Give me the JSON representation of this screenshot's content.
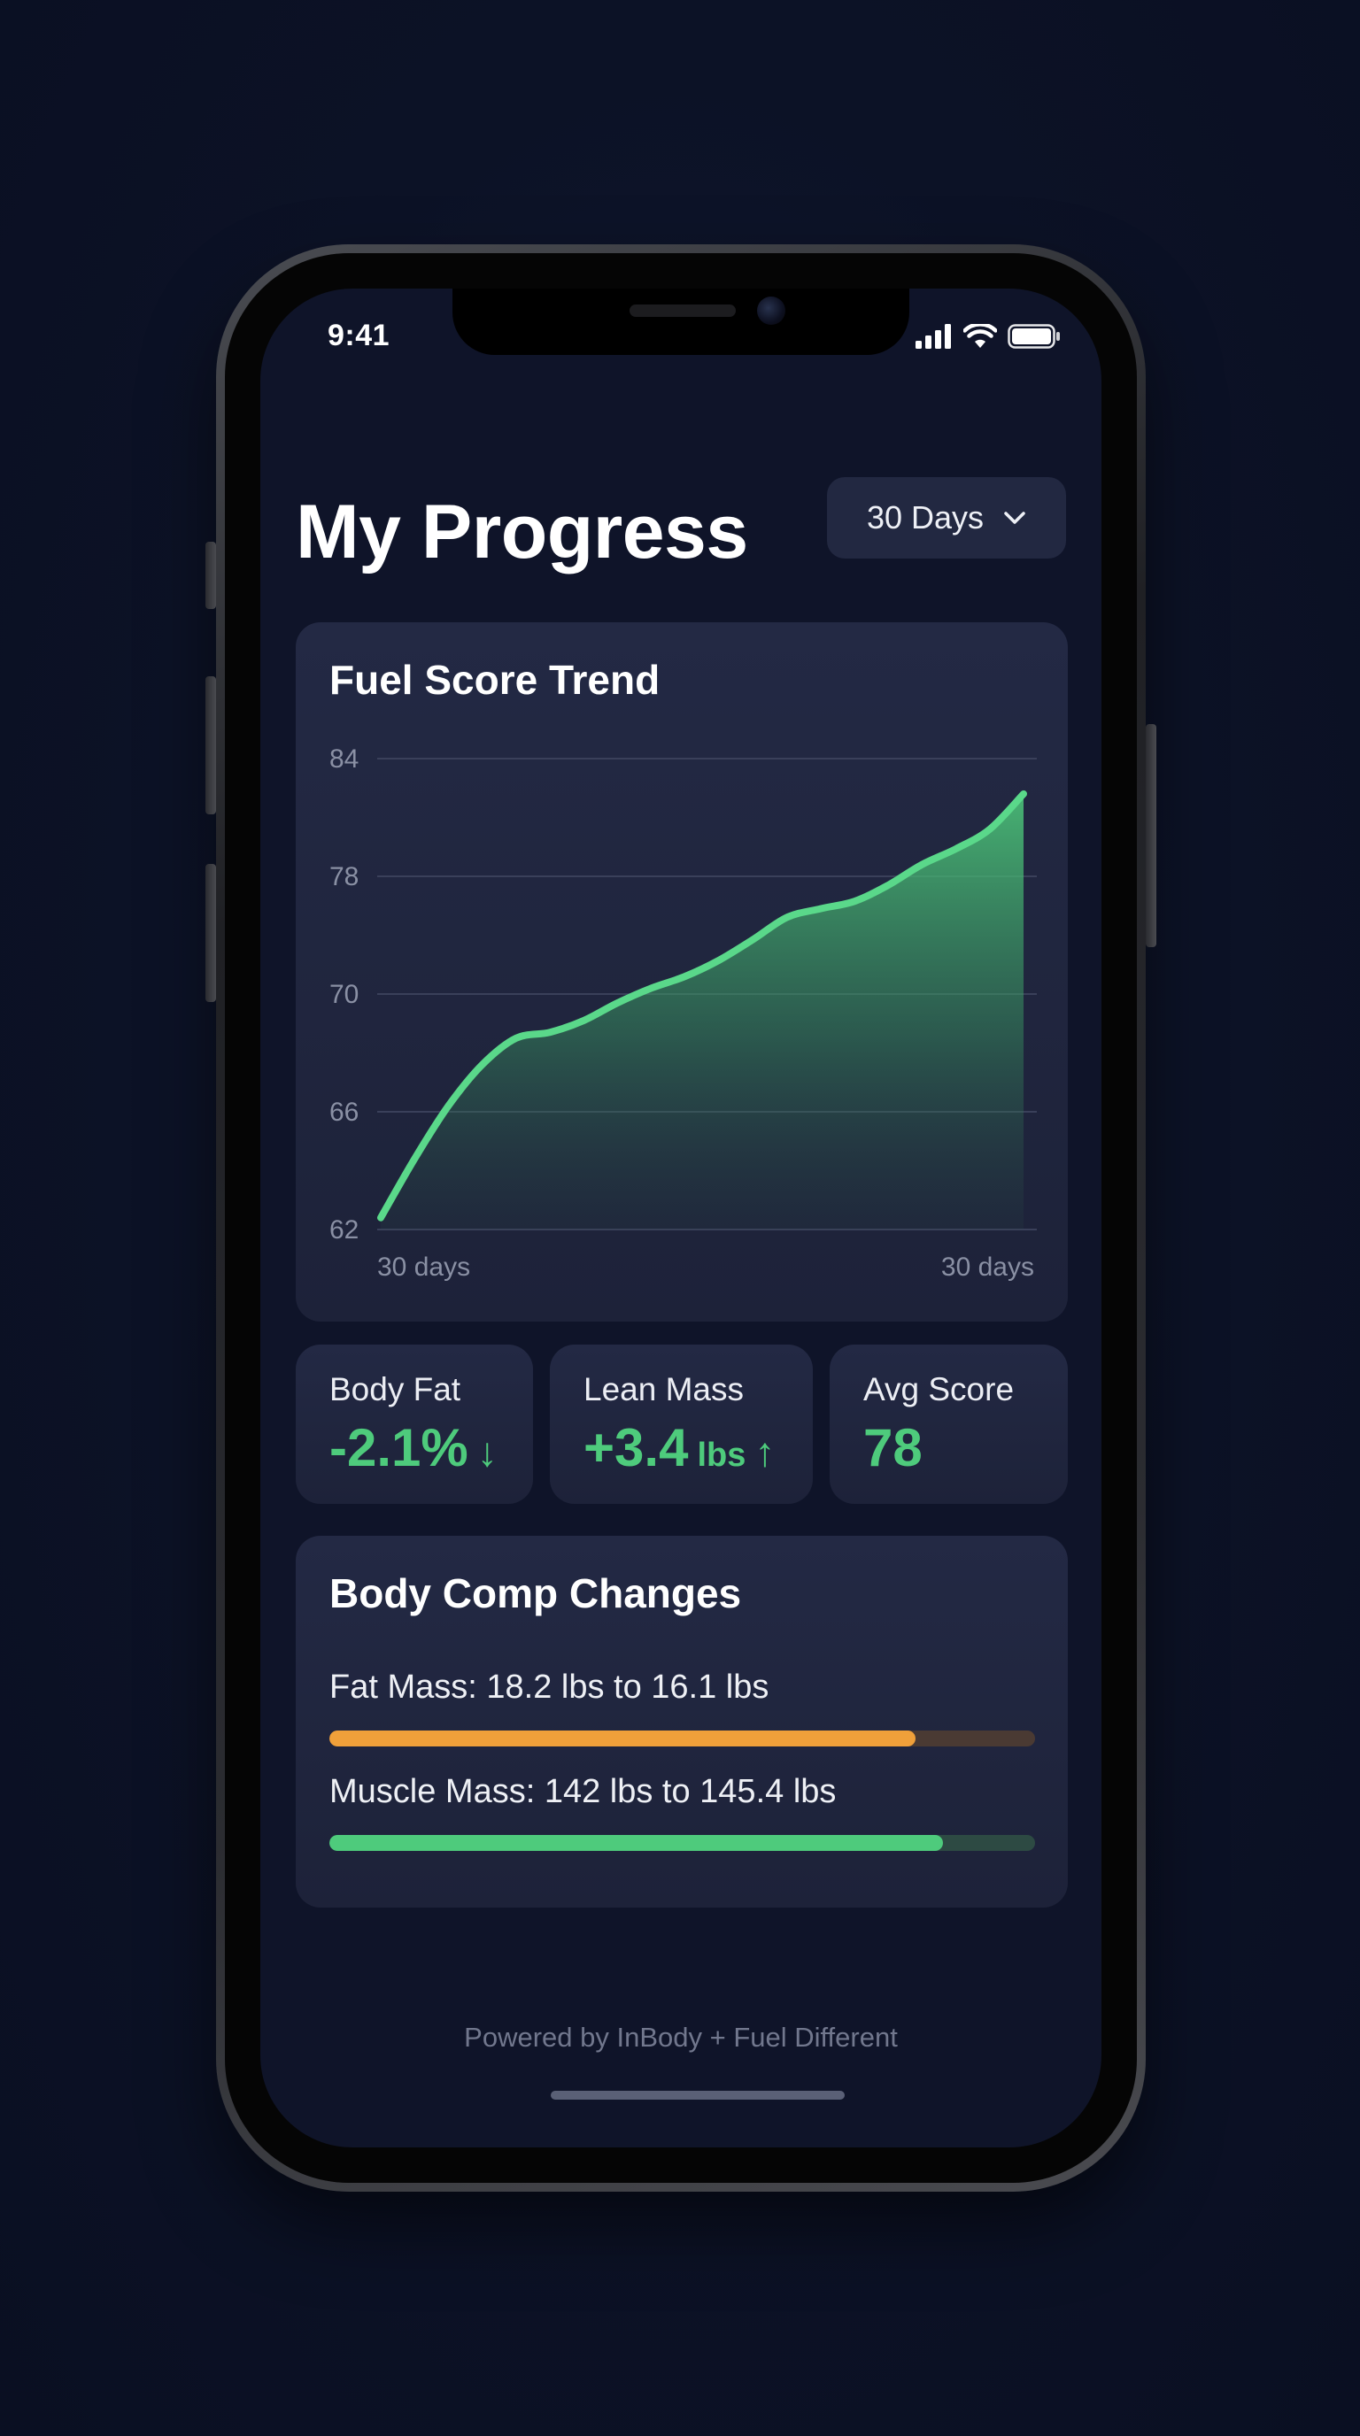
{
  "status_bar": {
    "time": "9:41"
  },
  "header": {
    "title": "My Progress",
    "range_label": "30 Days"
  },
  "fuel_card": {
    "title": "Fuel Score Trend",
    "x_start_label": "30 days",
    "x_end_label": "30 days"
  },
  "chart_data": {
    "type": "area",
    "title": "Fuel Score Trend",
    "xlabel": "",
    "ylabel": "",
    "y_ticks": [
      "84",
      "78",
      "70",
      "66",
      "62"
    ],
    "x_tick_labels": [
      "30 days",
      "30 days"
    ],
    "grid": true,
    "series": [
      {
        "values": [
          62.4,
          64.4,
          66.2,
          67.6,
          68.5,
          68.7,
          69.1,
          69.7,
          70.4,
          71.2,
          72.3,
          73.7,
          75.2,
          75.8,
          76.3,
          77.4,
          78.6,
          79.4,
          80.4,
          82.2
        ]
      }
    ]
  },
  "stats": [
    {
      "label": "Body Fat",
      "value": "-2.1%",
      "unit": "",
      "arrow": "↓"
    },
    {
      "label": "Lean Mass",
      "value": "+3.4",
      "unit": "lbs",
      "arrow": "↑"
    },
    {
      "label": "Avg Score",
      "value": "78",
      "unit": "",
      "arrow": ""
    }
  ],
  "body_comp": {
    "title": "Body Comp Changes",
    "bars": [
      {
        "label": "Fat Mass: 18.2 lbs to 16.1 lbs",
        "progress": 0.83,
        "color": "#f0a03a",
        "track_color": "#4a3a33"
      },
      {
        "label": "Muscle Mass: 142 lbs to 145.4 lbs",
        "progress": 0.87,
        "color": "#4ecb7c",
        "track_color": "#2d4a43"
      }
    ]
  },
  "footer": {
    "text": "Powered by InBody + Fuel Different"
  },
  "icons": {
    "signal": "cellular-signal-icon",
    "wifi": "wifi-icon",
    "battery": "battery-icon",
    "dropdown": "chevron-down-icon"
  },
  "colors": {
    "background": "#0c1226",
    "card": "#222841",
    "accent_green": "#4ecb7c",
    "accent_orange": "#f0a03a"
  }
}
